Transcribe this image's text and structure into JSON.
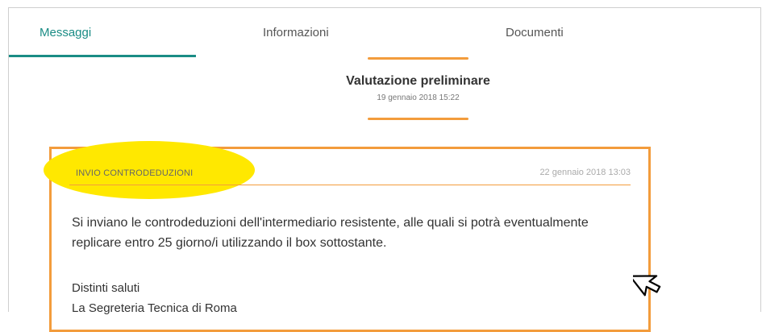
{
  "tabs": [
    {
      "label": "Messaggi",
      "active": true
    },
    {
      "label": "Informazioni",
      "active": false
    },
    {
      "label": "Documenti",
      "active": false
    }
  ],
  "header": {
    "title": "Valutazione preliminare",
    "timestamp": "19 gennaio 2018 15:22"
  },
  "message": {
    "subject": "INVIO CONTRODEDUZIONI",
    "date": "22 gennaio 2018 13:03",
    "body": "Si inviano le controdeduzioni dell'intermediario resistente, alle quali si potrà eventualmente replicare entro 25 giorno/i utilizzando il box sottostante.",
    "closing": "Distinti saluti",
    "signature": "La Segreteria Tecnica di Roma"
  },
  "colors": {
    "accent_teal": "#1a8c85",
    "accent_orange": "#f39c3c",
    "highlight_yellow": "#ffe800"
  },
  "icons": {
    "cursor": "pointer-cursor-icon"
  }
}
